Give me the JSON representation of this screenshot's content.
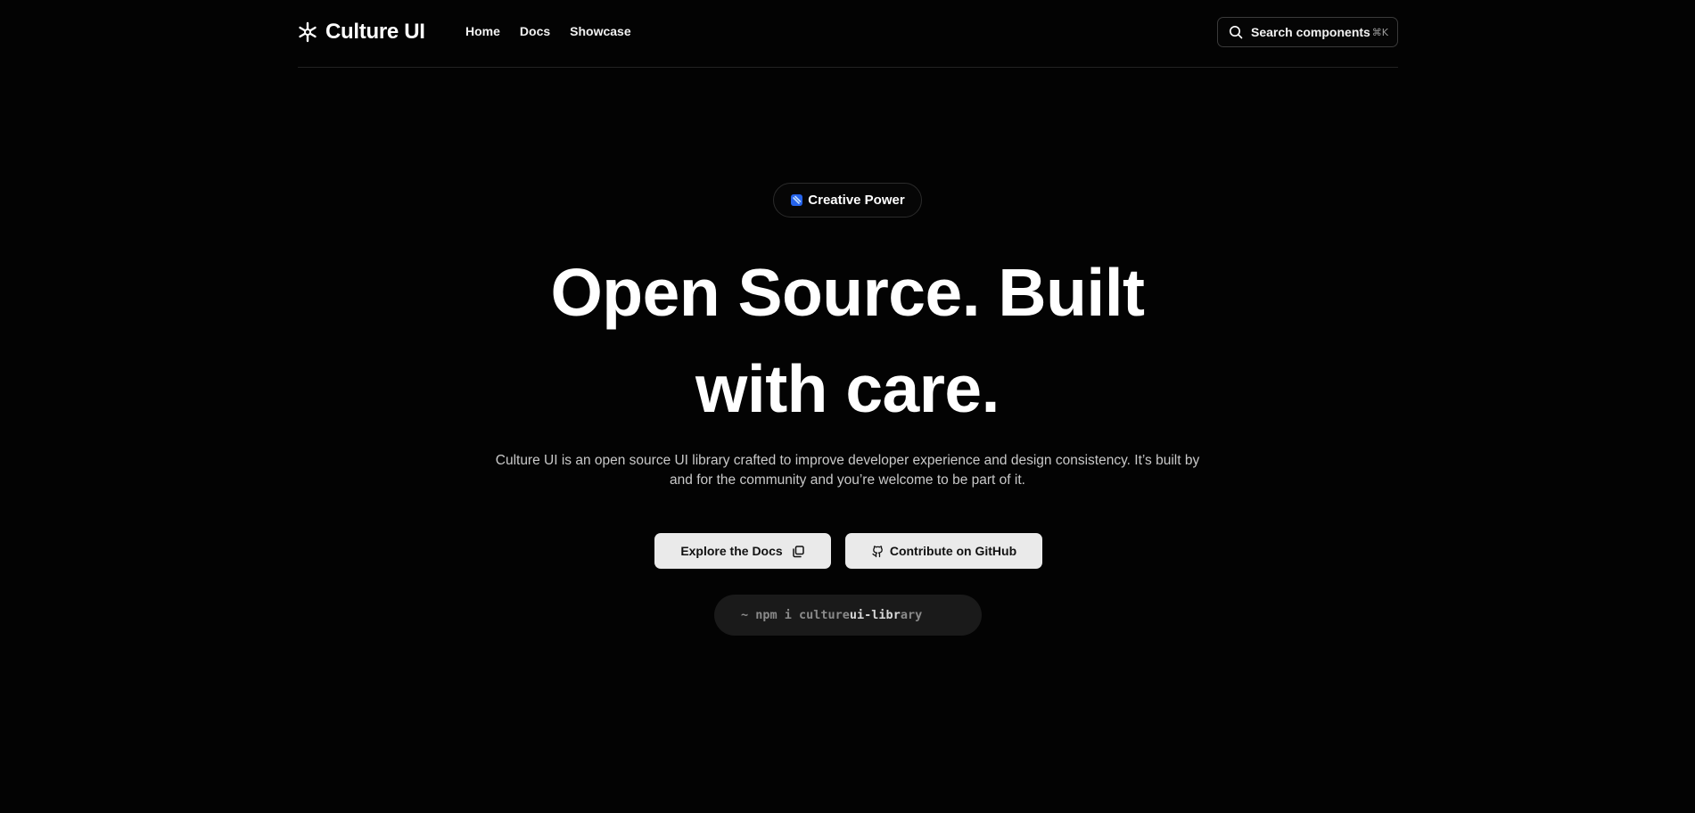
{
  "brand": {
    "name": "Culture UI",
    "icon": "snowflake-logo-icon"
  },
  "nav": {
    "items": [
      {
        "label": "Home"
      },
      {
        "label": "Docs"
      },
      {
        "label": "Showcase"
      }
    ]
  },
  "search": {
    "label": "Search components",
    "shortcut": "⌘K",
    "icon": "search-icon"
  },
  "hero": {
    "badge": {
      "label": "Creative Power",
      "icon": "sparkle-badge-icon"
    },
    "headline_line1": "Open Source. Built",
    "headline_line2": "with care.",
    "description": "Culture UI is an open source UI library crafted to improve developer experience and design consistency. It’s built by and for the community and you’re welcome to be part of it.",
    "primary_button": {
      "label": "Explore the Docs",
      "icon": "copy-icon"
    },
    "secondary_button": {
      "label": "Contribute on GitHub",
      "icon": "github-icon"
    },
    "install": {
      "prefix": "~ npm i culture",
      "highlight": "ui-libr",
      "suffix": "ary"
    }
  },
  "colors": {
    "background": "#030303",
    "text": "#ffffff",
    "muted": "#c9c9c9",
    "button_bg": "#eaeaea",
    "accent": "#3b82f6"
  }
}
